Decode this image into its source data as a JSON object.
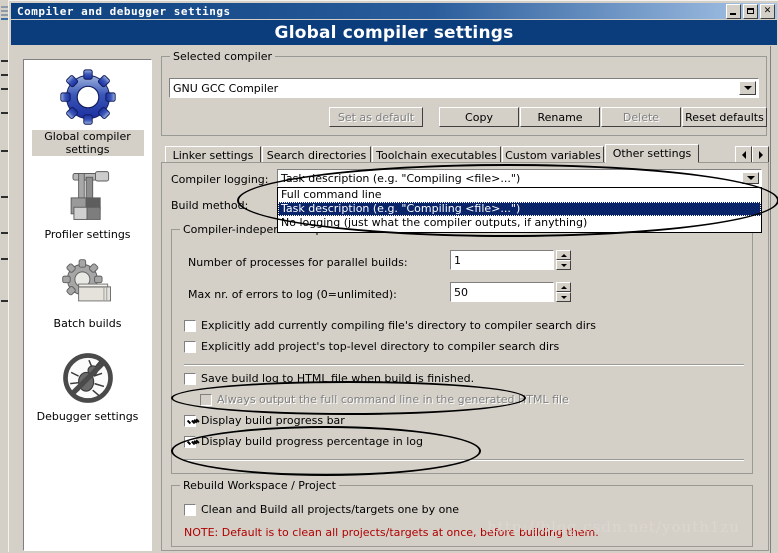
{
  "window": {
    "title": "Compiler and debugger settings",
    "header_title": "Global compiler settings",
    "buttons": {
      "minimize": "_",
      "maximize": "□",
      "close": "✕"
    }
  },
  "sidebar": {
    "items": [
      {
        "label": "Global compiler settings",
        "icon": "gear-icon",
        "selected": true
      },
      {
        "label": "Profiler settings",
        "icon": "caliper-icon",
        "selected": false
      },
      {
        "label": "Batch builds",
        "icon": "gear-pages-icon",
        "selected": false
      },
      {
        "label": "Debugger settings",
        "icon": "no-bug-icon",
        "selected": false
      }
    ]
  },
  "selected_compiler": {
    "group_caption": "Selected compiler",
    "combo_value": "GNU GCC Compiler",
    "buttons": [
      {
        "label": "Set as default",
        "enabled": false
      },
      {
        "label": "Copy",
        "enabled": true
      },
      {
        "label": "Rename",
        "enabled": true
      },
      {
        "label": "Delete",
        "enabled": false
      },
      {
        "label": "Reset defaults",
        "enabled": true
      }
    ]
  },
  "tabs": {
    "items": [
      {
        "label": "Linker settings",
        "active": false
      },
      {
        "label": "Search directories",
        "active": false
      },
      {
        "label": "Toolchain executables",
        "active": false
      },
      {
        "label": "Custom variables",
        "active": false
      },
      {
        "label": "Other settings",
        "active": true
      }
    ],
    "scroll_left": "◀",
    "scroll_right": "▶"
  },
  "other_settings": {
    "compiler_logging_label": "Compiler logging:",
    "compiler_logging_value": "Task description (e.g. \"Compiling <file>...\")",
    "compiler_logging_options": [
      "Full command line",
      "Task description (e.g. \"Compiling <file>...\")",
      "No logging (just what the compiler outputs, if anything)"
    ],
    "compiler_logging_selected_index": 1,
    "build_method_label": "Build method:",
    "independent_group_caption": "Compiler-independent options",
    "num_processes_label": "Number of processes for parallel builds:",
    "num_processes_value": "1",
    "max_errors_label": "Max nr. of errors to log (0=unlimited):",
    "max_errors_value": "50",
    "checkboxes": [
      {
        "label": "Explicitly add currently compiling file's directory to compiler search dirs",
        "checked": false,
        "enabled": true
      },
      {
        "label": "Explicitly add project's top-level directory to compiler search dirs",
        "checked": false,
        "enabled": true
      },
      {
        "label": "Save build log to HTML file when build is finished.",
        "checked": false,
        "enabled": true
      },
      {
        "label": "Always output the full command line in the generated HTML file",
        "checked": false,
        "enabled": false
      },
      {
        "label": "Display build progress bar",
        "checked": true,
        "enabled": true
      },
      {
        "label": "Display build progress percentage in log",
        "checked": true,
        "enabled": true
      }
    ],
    "rebuild_group_caption": "Rebuild Workspace / Project",
    "rebuild_checkbox": {
      "label": "Clean and Build all projects/targets one by one",
      "checked": false
    },
    "note": "NOTE: Default is to clean all projects/targets at once, before building them."
  },
  "annotations": {
    "ellipse_count": 3,
    "watermark": "http://blog.csdn.net/youth1zu"
  },
  "colors": {
    "titlebar_start": "#0c3f7d",
    "header_band": "#0b3d7d",
    "dialog_face": "#d4d0c8",
    "selection_blue": "#0a246a",
    "note_red": "#b00000",
    "disabled_gray": "#808080"
  }
}
